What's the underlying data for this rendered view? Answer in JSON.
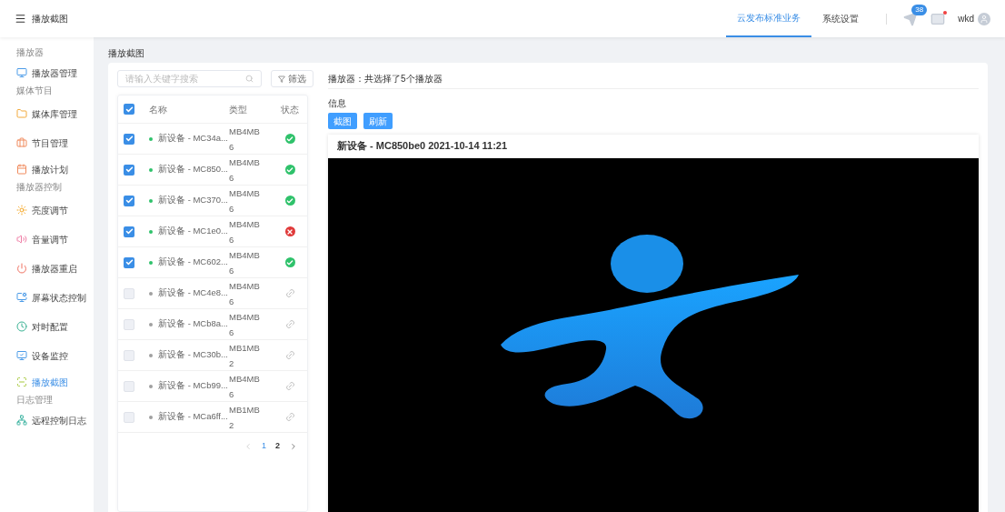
{
  "header": {
    "title": "播放截图",
    "nav": [
      {
        "label": "云发布标准业务",
        "selected": true
      },
      {
        "label": "系统设置",
        "selected": false
      }
    ],
    "notification_count": "38",
    "mail_unread": true,
    "user": "wkd"
  },
  "sidebar": {
    "groups": [
      {
        "label": "播放器",
        "items": [
          {
            "label": "播放器管理",
            "selected": false
          }
        ]
      },
      {
        "label": "媒体节目",
        "items": [
          {
            "label": "媒体库管理",
            "selected": false
          },
          {
            "label": "节目管理",
            "selected": false
          },
          {
            "label": "播放计划",
            "selected": false
          }
        ]
      },
      {
        "label": "播放器控制",
        "items": [
          {
            "label": "亮度调节",
            "selected": false
          },
          {
            "label": "音量调节",
            "selected": false
          },
          {
            "label": "播放器重启",
            "selected": false
          },
          {
            "label": "屏幕状态控制",
            "selected": false
          },
          {
            "label": "对时配置",
            "selected": false
          },
          {
            "label": "设备监控",
            "selected": false
          },
          {
            "label": "播放截图",
            "selected": true
          }
        ]
      },
      {
        "label": "日志管理",
        "items": [
          {
            "label": "远程控制日志",
            "selected": false
          }
        ]
      }
    ]
  },
  "breadcrumb": "播放截图",
  "search": {
    "placeholder": "请输入关键字搜索"
  },
  "filter_button": "筛选",
  "table": {
    "all_checked": true,
    "columns": [
      "名称",
      "类型",
      "状态"
    ],
    "rows": [
      {
        "checked": true,
        "color": "#2fc26b",
        "name": "新设备 - MC34a...",
        "type": "MB4MB6",
        "kind": "online"
      },
      {
        "checked": true,
        "color": "#2fc26b",
        "name": "新设备 - MC850...",
        "type": "MB4MB6",
        "kind": "online"
      },
      {
        "checked": true,
        "color": "#2fc26b",
        "name": "新设备 - MC370...",
        "type": "MB4MB6",
        "kind": "online"
      },
      {
        "checked": true,
        "color": "#2fc26b",
        "name": "新设备 - MC1e0...",
        "type": "MB4MB6",
        "kind": "fault"
      },
      {
        "checked": true,
        "color": "#2fc26b",
        "name": "新设备 - MC602...",
        "type": "MB4MB6",
        "kind": "online"
      },
      {
        "checked": false,
        "color": "#a0a0a0",
        "name": "新设备 - MC4e8...",
        "type": "MB4MB6",
        "kind": "offline"
      },
      {
        "checked": false,
        "color": "#a0a0a0",
        "name": "新设备 - MCb8a...",
        "type": "MB4MB6",
        "kind": "offline"
      },
      {
        "checked": false,
        "color": "#a0a0a0",
        "name": "新设备 - MC30b...",
        "type": "MB1MB2",
        "kind": "offline"
      },
      {
        "checked": false,
        "color": "#a0a0a0",
        "name": "新设备 - MCb99...",
        "type": "MB4MB6",
        "kind": "offline"
      },
      {
        "checked": false,
        "color": "#a0a0a0",
        "name": "新设备 - MCa6ff...",
        "type": "MB1MB2",
        "kind": "offline"
      }
    ]
  },
  "pagination": [
    {
      "label": "1",
      "selected": true
    },
    {
      "label": "2",
      "selected": false
    }
  ],
  "selection_summary": "播放器：共选择了5个播放器",
  "info_label": "信息",
  "buttons": [
    "截图",
    "刷新"
  ],
  "screenshot": {
    "title": "新设备 - MC850be0  2021-10-14 11:21"
  }
}
